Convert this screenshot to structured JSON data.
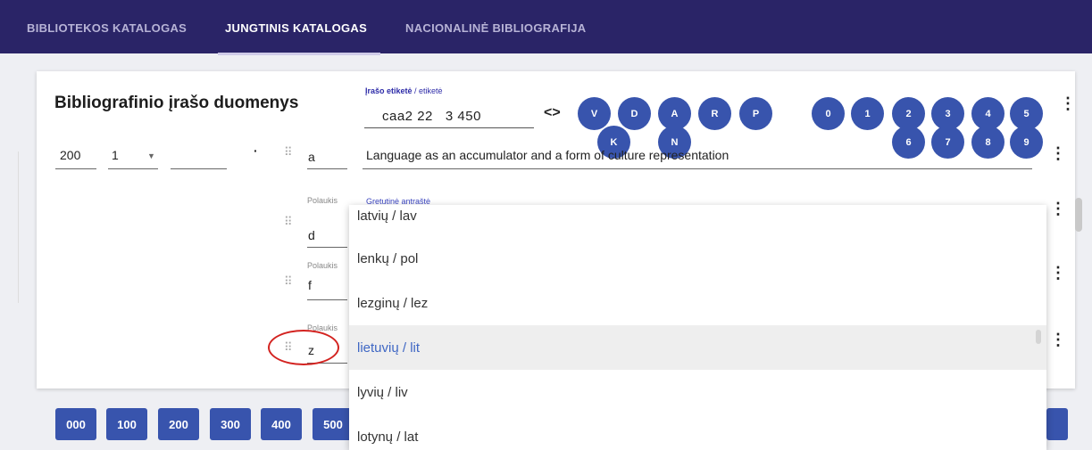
{
  "nav": {
    "tabs": [
      {
        "label": "BIBLIOTEKOS KATALOGAS"
      },
      {
        "label": "JUNGTINIS KATALOGAS"
      },
      {
        "label": "NACIONALINĖ BIBLIOGRAFIJA"
      }
    ],
    "active_tab": "JUNGTINIS KATALOGAS"
  },
  "record": {
    "title": "Bibliografinio įrašo duomenys",
    "label_caption": "Įrašo etiketė",
    "label_caption_alt": " / etiketė",
    "label_value": "caa2 22   3 450",
    "code_symbol": "<>",
    "letter_buttons": [
      "V",
      "D",
      "A",
      "R",
      "P",
      "K",
      "N"
    ],
    "number_buttons": [
      "0",
      "1",
      "2",
      "3",
      "4",
      "5",
      "6",
      "7",
      "8",
      "9"
    ],
    "field": {
      "tag": "200",
      "ind1": "1",
      "dot": "·",
      "subfields": [
        {
          "caption": "",
          "code": "a",
          "value": "Language as an accumulator and a form of culture representation"
        },
        {
          "caption": "Polaukis",
          "code": "d",
          "value_caption": "Gretutinė antraštė"
        },
        {
          "caption": "Polaukis",
          "code": "f"
        },
        {
          "caption": "Polaukis",
          "code": "z"
        }
      ]
    }
  },
  "dropdown": {
    "options": [
      {
        "label": "latvių / lav"
      },
      {
        "label": "lenkų / pol"
      },
      {
        "label": "lezginų / lez"
      },
      {
        "label": "lietuvių / lit",
        "selected": true
      },
      {
        "label": "lyvių / liv"
      },
      {
        "label": "lotynų / lat"
      }
    ]
  },
  "bottom_buttons": [
    "000",
    "100",
    "200",
    "300",
    "400",
    "500"
  ],
  "colors": {
    "nav_bg": "#2a2467",
    "accent": "#3854ad",
    "selected_text": "#3f67c4",
    "annotation": "#d32320"
  }
}
